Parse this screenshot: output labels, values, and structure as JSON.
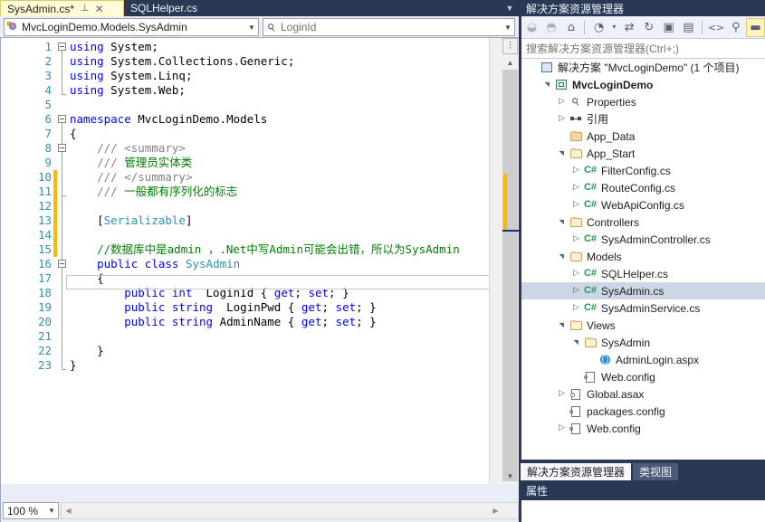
{
  "window": {
    "background": "#293955",
    "accent": "#fffcd8"
  },
  "tabs": {
    "items": [
      {
        "label": "SysAdmin.cs*",
        "active": true,
        "pin_icon": "pin-icon",
        "close_icon": "close-icon"
      },
      {
        "label": "SQLHelper.cs",
        "active": false
      }
    ],
    "overflow_icon": "chevron-down-icon"
  },
  "nav_bar": {
    "type_combo": {
      "value": "MvcLoginDemo.Models.SysAdmin",
      "icon": "class-icon",
      "arrow_icon": "chevron-down-icon"
    },
    "member_combo": {
      "value": "LoginId",
      "icon": "property-icon",
      "arrow_icon": "chevron-down-icon"
    }
  },
  "editor": {
    "zoom": "100 %",
    "zoom_arrow_icon": "chevron-down-icon",
    "split_icon": "split-view-icon",
    "scroll_up_icon": "triangle-up-icon",
    "scroll_down_icon": "triangle-down-icon",
    "h_scroll_left_icon": "triangle-left-icon",
    "h_scroll_right_icon": "triangle-right-icon",
    "change_bar_color": "#fcb900",
    "caret_mark_color": "#1b2f8c",
    "total_lines": 23,
    "lines": [
      {
        "n": 1,
        "outline": "collapse",
        "tokens": [
          {
            "t": "using",
            "c": "k"
          },
          {
            "t": " System;",
            "c": "pl"
          }
        ],
        "indent": 0
      },
      {
        "n": 2,
        "tokens": [
          {
            "t": "using",
            "c": "k"
          },
          {
            "t": " System.Collections.Generic;",
            "c": "pl"
          }
        ],
        "indent": 0
      },
      {
        "n": 3,
        "tokens": [
          {
            "t": "using",
            "c": "k"
          },
          {
            "t": " System.Linq;",
            "c": "pl"
          }
        ],
        "indent": 0
      },
      {
        "n": 4,
        "tokens": [
          {
            "t": "using",
            "c": "k"
          },
          {
            "t": " System.Web;",
            "c": "pl"
          }
        ],
        "indent": 0
      },
      {
        "n": 5,
        "tokens": []
      },
      {
        "n": 6,
        "outline": "collapse",
        "tokens": [
          {
            "t": "namespace",
            "c": "k"
          },
          {
            "t": " MvcLoginDemo.Models",
            "c": "pl"
          }
        ],
        "indent": 0
      },
      {
        "n": 7,
        "tokens": [
          {
            "t": "{",
            "c": "pl"
          }
        ],
        "indent": 0
      },
      {
        "n": 8,
        "outline": "collapse",
        "tokens": [
          {
            "t": "/// ",
            "c": "xd"
          },
          {
            "t": "<summary>",
            "c": "xd"
          }
        ],
        "indent": 4
      },
      {
        "n": 9,
        "tokens": [
          {
            "t": "/// ",
            "c": "xd"
          },
          {
            "t": "管理员实体类",
            "c": "c"
          }
        ],
        "indent": 4
      },
      {
        "n": 10,
        "tokens": [
          {
            "t": "/// ",
            "c": "xd"
          },
          {
            "t": "</summary>",
            "c": "xd"
          }
        ],
        "indent": 4
      },
      {
        "n": 11,
        "tokens": [
          {
            "t": "/// ",
            "c": "xd"
          },
          {
            "t": "一般都有序列化的标志",
            "c": "c"
          }
        ],
        "indent": 4
      },
      {
        "n": 12,
        "tokens": []
      },
      {
        "n": 13,
        "tokens": [
          {
            "t": "[",
            "c": "pl"
          },
          {
            "t": "Serializable",
            "c": "t"
          },
          {
            "t": "]",
            "c": "pl"
          }
        ],
        "indent": 4
      },
      {
        "n": 14,
        "tokens": []
      },
      {
        "n": 15,
        "tokens": [
          {
            "t": "//数据库中是admin ，.Net中写Admin可能会出错，所以为SysAdmin",
            "c": "c"
          }
        ],
        "indent": 4
      },
      {
        "n": 16,
        "outline": "collapse",
        "tokens": [
          {
            "t": "public",
            "c": "k"
          },
          {
            "t": " ",
            "c": "pl"
          },
          {
            "t": "class",
            "c": "k"
          },
          {
            "t": " ",
            "c": "pl"
          },
          {
            "t": "SysAdmin",
            "c": "t"
          }
        ],
        "indent": 4
      },
      {
        "n": 17,
        "tokens": [
          {
            "t": "{",
            "c": "pl"
          }
        ],
        "indent": 4
      },
      {
        "n": 18,
        "tokens": [
          {
            "t": "public",
            "c": "k"
          },
          {
            "t": " ",
            "c": "pl"
          },
          {
            "t": "int",
            "c": "k"
          },
          {
            "t": "  LoginId { ",
            "c": "pl"
          },
          {
            "t": "get",
            "c": "k"
          },
          {
            "t": "; ",
            "c": "pl"
          },
          {
            "t": "set",
            "c": "k"
          },
          {
            "t": "; }",
            "c": "pl"
          }
        ],
        "indent": 8
      },
      {
        "n": 19,
        "tokens": [
          {
            "t": "public",
            "c": "k"
          },
          {
            "t": " ",
            "c": "pl"
          },
          {
            "t": "string",
            "c": "k"
          },
          {
            "t": "  LoginPwd { ",
            "c": "pl"
          },
          {
            "t": "get",
            "c": "k"
          },
          {
            "t": "; ",
            "c": "pl"
          },
          {
            "t": "set",
            "c": "k"
          },
          {
            "t": "; }",
            "c": "pl"
          }
        ],
        "indent": 8
      },
      {
        "n": 20,
        "tokens": [
          {
            "t": "public",
            "c": "k"
          },
          {
            "t": " ",
            "c": "pl"
          },
          {
            "t": "string",
            "c": "k"
          },
          {
            "t": " AdminName { ",
            "c": "pl"
          },
          {
            "t": "get",
            "c": "k"
          },
          {
            "t": "; ",
            "c": "pl"
          },
          {
            "t": "set",
            "c": "k"
          },
          {
            "t": "; }",
            "c": "pl"
          }
        ],
        "indent": 8
      },
      {
        "n": 21,
        "tokens": []
      },
      {
        "n": 22,
        "tokens": [
          {
            "t": "}",
            "c": "pl"
          }
        ],
        "indent": 4
      },
      {
        "n": 23,
        "tokens": [
          {
            "t": "}",
            "c": "pl"
          }
        ],
        "indent": 0
      }
    ]
  },
  "solution_explorer": {
    "title": "解决方案资源管理器",
    "search_placeholder": "搜索解决方案资源管理器(Ctrl+;)",
    "toolbar": [
      {
        "name": "back-icon",
        "glyph": "◒",
        "state": "disabled"
      },
      {
        "name": "forward-icon",
        "glyph": "◓",
        "state": "disabled"
      },
      {
        "name": "home-icon",
        "glyph": "⌂",
        "state": "normal"
      },
      {
        "name": "pending-changes-filter-icon",
        "glyph": "◔",
        "state": "normal"
      },
      {
        "name": "filter-dropdown-icon",
        "glyph": "▾",
        "state": "normal"
      },
      {
        "name": "sync-with-active-document-icon",
        "glyph": "⇄",
        "state": "normal"
      },
      {
        "name": "refresh-icon",
        "glyph": "↻",
        "state": "normal"
      },
      {
        "name": "collapse-all-icon",
        "glyph": "▣",
        "state": "normal"
      },
      {
        "name": "show-all-files-icon",
        "glyph": "▤",
        "state": "normal"
      },
      {
        "name": "view-code-icon",
        "glyph": "<>",
        "state": "normal"
      },
      {
        "name": "properties-icon",
        "glyph": "⚲",
        "state": "normal"
      },
      {
        "name": "preview-selected-items-icon",
        "glyph": "▬",
        "state": "hot"
      }
    ],
    "tree": [
      {
        "label": "解决方案 \"MvcLoginDemo\" (1 个项目)",
        "depth": 0,
        "twisty": "none",
        "icon": "solution-icon",
        "bold": false
      },
      {
        "label": "MvcLoginDemo",
        "depth": 1,
        "twisty": "expanded",
        "icon": "project-icon",
        "bold": true
      },
      {
        "label": "Properties",
        "depth": 2,
        "twisty": "collapsed",
        "icon": "wrench-icon",
        "bold": false
      },
      {
        "label": "引用",
        "depth": 2,
        "twisty": "collapsed",
        "icon": "references-icon",
        "bold": false
      },
      {
        "label": "App_Data",
        "depth": 2,
        "twisty": "none",
        "icon": "folder-icon",
        "bold": false
      },
      {
        "label": "App_Start",
        "depth": 2,
        "twisty": "expanded",
        "icon": "folder-open-icon",
        "bold": false
      },
      {
        "label": "FilterConfig.cs",
        "depth": 3,
        "twisty": "collapsed",
        "icon": "csharp-file-icon",
        "bold": false
      },
      {
        "label": "RouteConfig.cs",
        "depth": 3,
        "twisty": "collapsed",
        "icon": "csharp-file-icon",
        "bold": false
      },
      {
        "label": "WebApiConfig.cs",
        "depth": 3,
        "twisty": "collapsed",
        "icon": "csharp-file-icon",
        "bold": false
      },
      {
        "label": "Controllers",
        "depth": 2,
        "twisty": "expanded",
        "icon": "folder-open-icon",
        "bold": false
      },
      {
        "label": "SysAdminController.cs",
        "depth": 3,
        "twisty": "collapsed",
        "icon": "csharp-file-icon",
        "bold": false
      },
      {
        "label": "Models",
        "depth": 2,
        "twisty": "expanded",
        "icon": "folder-open-icon",
        "bold": false
      },
      {
        "label": "SQLHelper.cs",
        "depth": 3,
        "twisty": "collapsed",
        "icon": "csharp-file-icon",
        "bold": false
      },
      {
        "label": "SysAdmin.cs",
        "depth": 3,
        "twisty": "collapsed",
        "icon": "csharp-file-icon",
        "bold": false,
        "selected": true
      },
      {
        "label": "SysAdminService.cs",
        "depth": 3,
        "twisty": "collapsed",
        "icon": "csharp-file-icon",
        "bold": false
      },
      {
        "label": "Views",
        "depth": 2,
        "twisty": "expanded",
        "icon": "folder-open-icon",
        "bold": false
      },
      {
        "label": "SysAdmin",
        "depth": 3,
        "twisty": "expanded",
        "icon": "folder-open-icon",
        "bold": false
      },
      {
        "label": "AdminLogin.aspx",
        "depth": 4,
        "twisty": "none",
        "icon": "aspx-file-icon",
        "bold": false
      },
      {
        "label": "Web.config",
        "depth": 3,
        "twisty": "none",
        "icon": "config-file-icon",
        "bold": false
      },
      {
        "label": "Global.asax",
        "depth": 2,
        "twisty": "collapsed",
        "icon": "asax-file-icon",
        "bold": false
      },
      {
        "label": "packages.config",
        "depth": 2,
        "twisty": "none",
        "icon": "config-file-icon",
        "bold": false
      },
      {
        "label": "Web.config",
        "depth": 2,
        "twisty": "collapsed",
        "icon": "config-file-icon",
        "bold": false
      }
    ],
    "bottom_tabs": [
      {
        "label": "解决方案资源管理器",
        "active": true
      },
      {
        "label": "类视图",
        "active": false
      }
    ]
  },
  "properties_panel": {
    "title": "属性"
  }
}
